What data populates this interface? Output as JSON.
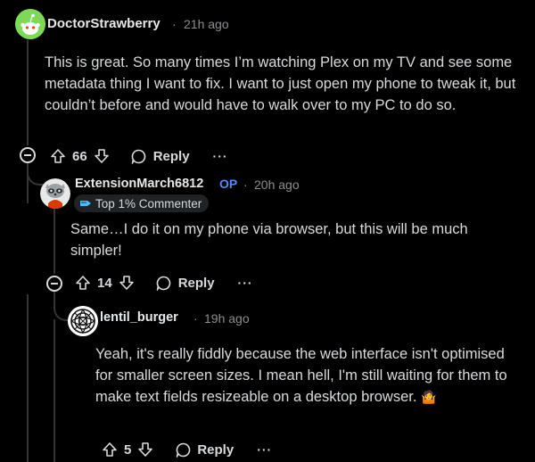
{
  "comments": [
    {
      "username": "DoctorStrawberry",
      "time": "21h ago",
      "body": "This is great. So many times I’m watching Plex on my TV and see some metadata thing I want to fix. I want to just open my phone to tweak it, but couldn’t before and would have to walk over to my PC to do so.",
      "score": "66",
      "reply_label": "Reply",
      "more_label": "···",
      "avatar_icon": "snoo-avatar-green",
      "accent": "#7ed957"
    },
    {
      "username": "ExtensionMarch6812",
      "op_label": "OP",
      "time": "20h ago",
      "flair": "Top 1% Commenter",
      "flair_icon": "commenter-badge-icon",
      "body": "Same…I do it on my phone via browser, but this will be much simpler!",
      "score": "14",
      "reply_label": "Reply",
      "more_label": "···",
      "avatar_icon": "snoo-avatar-raccoon",
      "op_color": "#4f8df7"
    },
    {
      "username": "lentil_burger",
      "time": "19h ago",
      "body": "Yeah, it's really fiddly because the web interface isn't optimised for smaller screen sizes. I mean hell, I'm still waiting for them to make text fields resizeable on a desktop browser.",
      "emoji": "🤷",
      "score": "5",
      "reply_label": "Reply",
      "more_label": "···",
      "avatar_icon": "knot-avatar-icon"
    }
  ],
  "separator": "·",
  "icons": [
    "upvote-icon",
    "downvote-icon",
    "reply-bubble-icon",
    "collapse-icon",
    "more-icon"
  ]
}
